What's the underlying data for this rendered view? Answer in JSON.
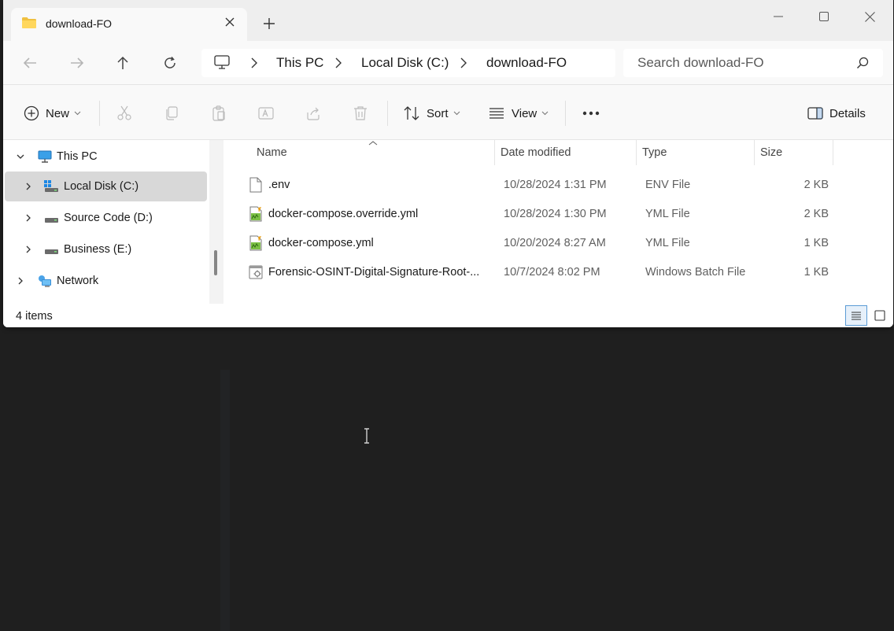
{
  "window": {
    "tab_title": "download-FO",
    "new_tab_icon": "plus-icon",
    "controls": [
      "minimize-icon",
      "maximize-icon",
      "close-icon"
    ]
  },
  "address": {
    "nav_buttons": [
      "back-arrow-icon",
      "forward-arrow-icon",
      "up-arrow-icon",
      "refresh-icon"
    ],
    "breadcrumb": [
      "This PC",
      "Local Disk (C:)",
      "download-FO"
    ],
    "search_placeholder": "Search download-FO"
  },
  "toolbar": {
    "new_label": "New",
    "sort_label": "Sort",
    "view_label": "View",
    "details_label": "Details",
    "more_icon": "ellipsis-icon"
  },
  "nav": {
    "items": [
      {
        "label": "This PC",
        "icon": "computer-icon",
        "expanded": true
      },
      {
        "label": "Local Disk (C:)",
        "icon": "drive-icon",
        "selected": true
      },
      {
        "label": "Source Code (D:)",
        "icon": "drive-icon"
      },
      {
        "label": "Business (E:)",
        "icon": "drive-icon"
      },
      {
        "label": "Network",
        "icon": "network-icon"
      }
    ]
  },
  "table": {
    "columns": [
      "Name",
      "Date modified",
      "Type",
      "Size"
    ],
    "rows": [
      {
        "name": ".env",
        "date": "10/28/2024 1:31 PM",
        "type": "ENV File",
        "size": "2 KB",
        "icon": "file-icon"
      },
      {
        "name": "docker-compose.override.yml",
        "date": "10/28/2024 1:30 PM",
        "type": "YML File",
        "size": "2 KB",
        "icon": "yml-file-icon"
      },
      {
        "name": "docker-compose.yml",
        "date": "10/20/2024 8:27 AM",
        "type": "YML File",
        "size": "1 KB",
        "icon": "yml-file-icon"
      },
      {
        "name": "Forensic-OSINT-Digital-Signature-Root-...",
        "date": "10/7/2024 8:02 PM",
        "type": "Windows Batch File",
        "size": "1 KB",
        "icon": "batch-file-icon"
      }
    ]
  },
  "status": {
    "item_count": "4 items"
  },
  "colors": {
    "window_bg": "#ffffff",
    "titlebar_bg": "#eeeeee",
    "selected_nav": "#d8d8d8",
    "desktop_bg": "#1f1f1f",
    "accent": "#005fb8"
  }
}
